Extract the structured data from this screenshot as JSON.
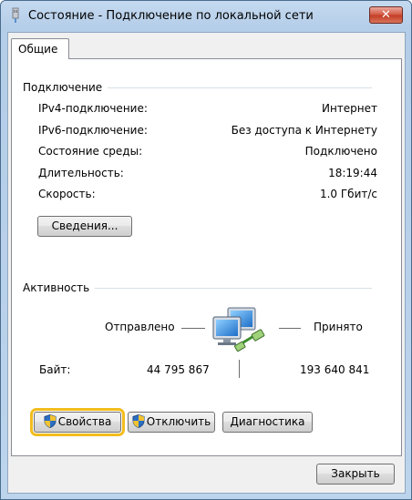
{
  "window": {
    "title": "Состояние - Подключение по локальной сети",
    "close_glyph": "✕"
  },
  "tabs": [
    {
      "label": "Общие",
      "active": true
    }
  ],
  "connection": {
    "heading": "Подключение",
    "rows": [
      {
        "label": "IPv4-подключение:",
        "value": "Интернет"
      },
      {
        "label": "IPv6-подключение:",
        "value": "Без доступа к Интернету"
      },
      {
        "label": "Состояние среды:",
        "value": "Подключено"
      },
      {
        "label": "Длительность:",
        "value": "18:19:44"
      },
      {
        "label": "Скорость:",
        "value": "1.0 Гбит/с"
      }
    ],
    "details_button": "Сведения..."
  },
  "activity": {
    "heading": "Активность",
    "sent_label": "Отправлено",
    "received_label": "Принято",
    "bytes_label": "Байт:",
    "bytes_sent": "44 795 867",
    "bytes_received": "193 640 841"
  },
  "actions": {
    "properties_button": "Свойства",
    "disable_button": "Отключить",
    "diagnose_button": "Диагностика"
  },
  "footer": {
    "close_button": "Закрыть"
  },
  "icons": {
    "title": "network-adapter-icon",
    "activity": "network-computers-icon",
    "shield": "uac-shield-icon"
  },
  "colors": {
    "focus_outline": "#f2bd1d",
    "close_button": "#c9452d",
    "frame": "#b9d1ea"
  }
}
